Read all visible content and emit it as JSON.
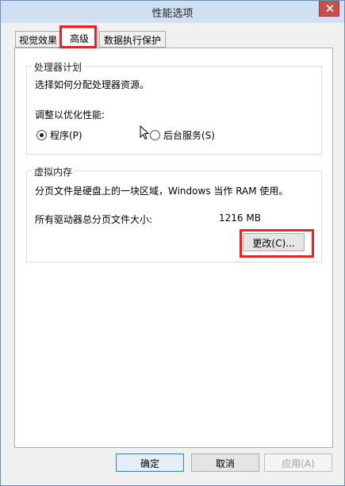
{
  "window": {
    "title": "性能选项"
  },
  "tabs": [
    {
      "label": "视觉效果"
    },
    {
      "label": "高级"
    },
    {
      "label": "数据执行保护"
    }
  ],
  "processor": {
    "legend": "处理器计划",
    "description": "选择如何分配处理器资源。",
    "adjust_label": "调整以优化性能:",
    "options": [
      {
        "label": "程序(P)",
        "checked": true
      },
      {
        "label": "后台服务(S)",
        "checked": false
      }
    ]
  },
  "virtual_memory": {
    "legend": "虚拟内存",
    "description": "分页文件是硬盘上的一块区域，Windows 当作 RAM 使用。",
    "total_label": "所有驱动器总分页文件大小:",
    "total_value": "1216 MB",
    "change_button": "更改(C)..."
  },
  "footer": {
    "ok": "确定",
    "cancel": "取消",
    "apply": "应用(A)"
  },
  "colors": {
    "annotation": "#e3242b",
    "titlebar": "#cfe0f3",
    "close_button": "#c7504d"
  }
}
